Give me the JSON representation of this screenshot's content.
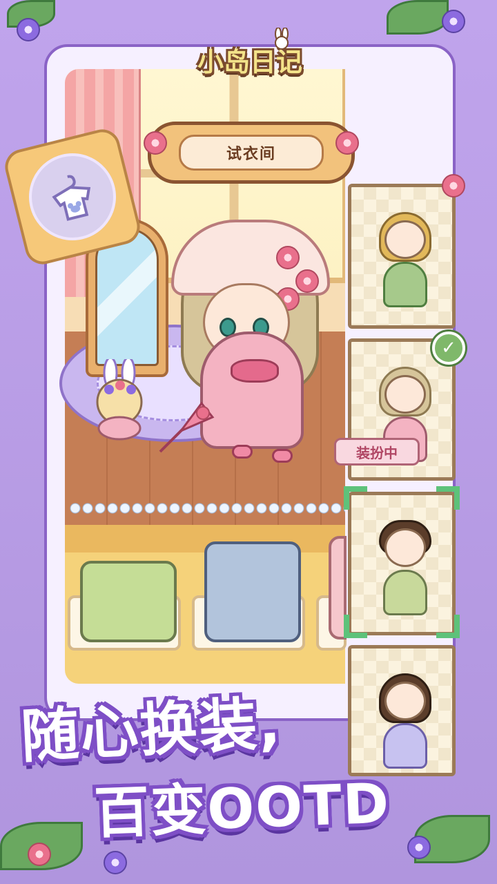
{
  "app": {
    "logo_text": "小岛日记"
  },
  "fitting_room": {
    "title": "试衣间"
  },
  "outfits": {
    "cards": [
      {
        "hair_color": "#e2b85a",
        "outfit_color": "#a6c98b",
        "selected": false,
        "equipped": false
      },
      {
        "hair_color": "#d6c59a",
        "outfit_color": "#f4b3c2",
        "selected": false,
        "equipped": true
      },
      {
        "hair_color": "#5b3d2a",
        "outfit_color": "#c8d99b",
        "selected": true,
        "equipped": false
      },
      {
        "hair_color": "#5b3d2a",
        "outfit_color": "#c7c2f0",
        "selected": false,
        "equipped": false
      }
    ],
    "equipped_label": "装扮中"
  },
  "slogan": {
    "line1": "随心换装,",
    "line2": "百变OOTD"
  },
  "colors": {
    "background": "#b79be0",
    "frame_border": "#8a63c6",
    "accent_green": "#5ec27a",
    "accent_pink": "#e46a8c"
  },
  "icons": {
    "badge": "hanger-shirt-icon",
    "check": "check-icon"
  }
}
